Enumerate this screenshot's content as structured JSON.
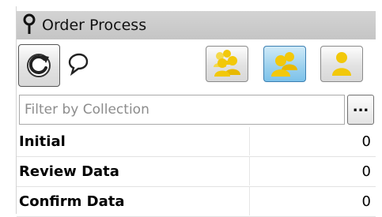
{
  "panel": {
    "title": "Order Process",
    "icons": {
      "pin": "pin-icon",
      "refresh": "refresh-icon",
      "comment": "comment-icon",
      "all_users": "user-group-icon",
      "team": "team-icon",
      "single_user": "user-icon"
    },
    "filter": {
      "placeholder": "Filter by Collection",
      "value": ""
    },
    "more_button_label": "...",
    "rows": [
      {
        "label": "Initial",
        "count": "0"
      },
      {
        "label": "Review Data",
        "count": "0"
      },
      {
        "label": "Confirm Data",
        "count": "0"
      }
    ],
    "colors": {
      "title_bar": "#c9c9c9",
      "active_button": "#9ed2ee",
      "user_icon": "#f2c80a"
    }
  }
}
